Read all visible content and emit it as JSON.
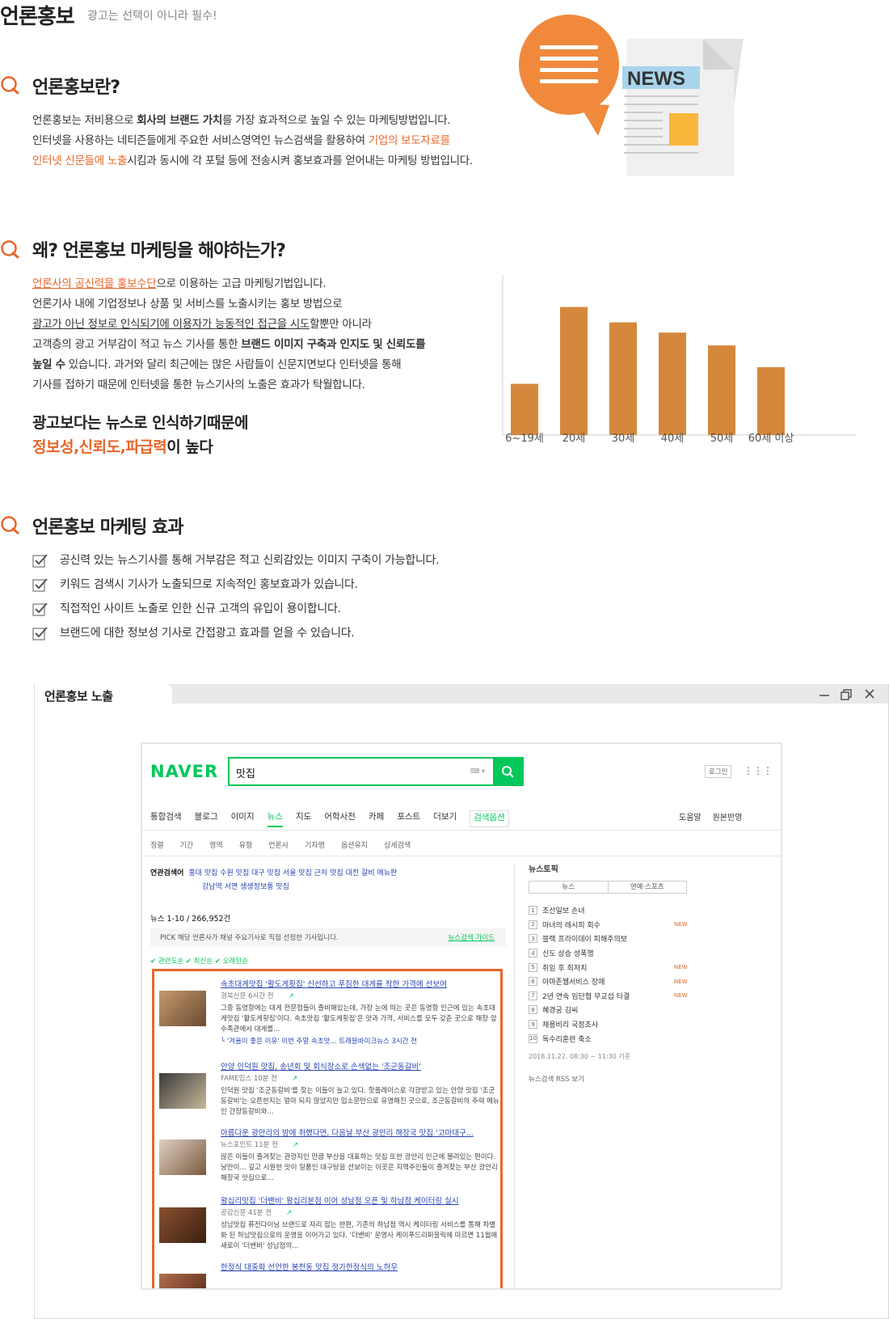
{
  "header": {
    "title": "언론홍보",
    "subtitle": "광고는 선택이 아니라 필수!"
  },
  "hero_icon": {
    "label": "NEWS",
    "colors": {
      "bubble": "#f0893c",
      "paper": "#ececec",
      "tag": "#a9d4ec",
      "square": "#f8b73a"
    }
  },
  "section1": {
    "title": "언론홍보란?",
    "lines": [
      [
        "언론홍보는 저비용으로 ",
        "회사의 브랜드 가치",
        "를 가장 효과적으로 높일 수 있는 마케팅방법입니다."
      ],
      [
        "인터넷을 사용하는 네티즌들에게 주요한 서비스영역인 뉴스검색을 활용하여 ",
        "기업의 보도자료를"
      ],
      [
        "인터넷 신문들에 노출",
        "시킴과 동시에 각 포털 등에 전송시켜 홍보효과를 얻어내는 마케팅 방법입니다."
      ]
    ]
  },
  "section2": {
    "title": "왜? 언론홍보 마케팅을 해야하는가?",
    "line1": [
      "언론사의 공신력을 홍보수단",
      "으로 이용하는 고급 마케팅기법입니다."
    ],
    "line2": "언론기사 내에 기업정보나 상품 및 서비스를 노출시키는 홍보 방법으로",
    "line3": [
      "광고가 아닌 정보로 인식되기에 이용자가 능동적인 접근을 시도",
      "할뿐만 아니라"
    ],
    "line4": [
      "고객층의 광고 거부감이 적고 뉴스 기사를 통한 ",
      "브랜드 이미지 구축과 인지도 및 신뢰도를"
    ],
    "line5": [
      "높일 수",
      " 있습니다. 과거와 달리 최근에는 많은 사람들이 신문지면보다 인터넷을 통해"
    ],
    "line6": "기사를 접하기 때문에 인터넷을 통한 뉴스기사의 노출은 효과가 탁월합니다.",
    "highlight1": "광고보다는 뉴스로 인식하기때문에",
    "highlight2": [
      "정보성,신뢰도,파급력",
      "이 높다"
    ]
  },
  "chart_data": {
    "type": "bar",
    "categories": [
      "6~19세",
      "20세",
      "30세",
      "40세",
      "50세",
      "60세 이상"
    ],
    "values": [
      40,
      100,
      88,
      80,
      70,
      53
    ],
    "ylim": [
      0,
      125
    ],
    "color": "#d5883c"
  },
  "section3": {
    "title": "언론홍보 마케팅 효과",
    "items": [
      "공신력 있는 뉴스기사를 통해 거부감은 적고 신뢰감있는 이미지 구축이 가능합니다.",
      "키워드 검색시 기사가 노출되므로 지속적인 홍보효과가 있습니다.",
      "직접적인 사이트 노출로 인한 신규 고객의 유입이 용이합니다.",
      "브랜드에 대한 정보성 기사로 간접광고 효과를 얻을 수 있습니다."
    ]
  },
  "window": {
    "title": "언론홍보 노출"
  },
  "naver": {
    "logo": "NAVER",
    "query": "맛집",
    "login": "로그인",
    "tabs": [
      "통합검색",
      "블로그",
      "이미지",
      "뉴스",
      "지도",
      "어학사전",
      "카페",
      "포스트",
      "더보기",
      "검색옵션"
    ],
    "tabs_right": [
      "도움말",
      "원본반영"
    ],
    "filters": [
      "정렬",
      "기간",
      "영역",
      "유형",
      "언론사",
      "기자명",
      "옵션유지",
      "상세검색"
    ],
    "related_label": "연관검색어",
    "related1": "홍대 맛집   수원 맛집   대구 맛집   서울 맛집   근처 맛집   대전 갈비   메뉴판",
    "related2": "강남역   서면   생생정보통 맛집",
    "news_count": "뉴스  1-10 / 266,952건",
    "pick": "PICK  해당 언론사가 채널 주요기사로 직접 선정한 기사입니다.",
    "pick_guide": "뉴스검색 가이드",
    "sort": "✔ 관련도순  ✔ 최신순  ✔ 오래된순",
    "results": [
      {
        "title": "속초대게맛집 '활도게횟집' 신선하고 푸짐한 대게를 착한 가격에 선보여",
        "meta": "경북신문  6시간 전",
        "desc": "그중 동명항에는 대게 전문점들이 즐비해있는데, 가장 눈에 띄는 곳은 동명항 인근에 있는 속초대게맛집 '활도게횟집'이다. 속초맛집 '활도게횟집'은 맛과 가격, 서비스를 모두 갖춘 곳으로 해장 앞 수족관에서 대게를...",
        "extra": "└ '겨울이 좋은 이유' 이번 주말 속초맛...   트래블바이크뉴스   3시간 전"
      },
      {
        "title": "안양 인덕원 맛집, 송년회 및 회식장소로 손색없는 '조군동갈비'",
        "meta": "FAME임스  10분 전",
        "desc": "인덕원 맛집 '조군동갈비'를 찾는 이들이 늘고 있다. 핫플레이스로 각광받고 있는 안양 맛집 '조군동갈비'는 오픈한지는 얼마 되지 않았지만 입소문만으로 유명해진 곳으로, 조군동갈비의 주력 메뉴인 간장동갈비와...",
        "extra": ""
      },
      {
        "title": "아름다운 광안리의 밤에 취했다면, 다음날 부산 광안리 해장국 맛집 '고마대구...",
        "meta": "뉴스포인트  11분 전",
        "desc": "많은 이들이 즐겨찾는 관광지인 만큼 부산을 대표하는 맛집 또한 광안리 인근에 몰려있는 편이다. 낭만이... 깊고 시원한 맛이 일품인 대구탕을 선보이는 이곳은 지역주민들이 즐겨찾는 부산 광안리 해장국 맛집으로...",
        "extra": ""
      },
      {
        "title": "왕십리맛집 '더밴비' 왕십리본점 이어 성남점 오픈 및 하남점 케이터링 실시",
        "meta": "공감신문  41분 전",
        "desc": "성남맛집 퓨전다이닝 브랜드로 자리 잡는 한편, 기존의 하남점 역시 케이터링 서비스를 통해 차별화 된 하남맛집으로의 운영을 이어가고 있다. '더밴비' 운영사 케이푸드리퍼블릭에 따르면 11월에 새로이 '더밴비' 성남점의...",
        "extra": ""
      },
      {
        "title": "한정식 대중화 선언한 봉천동 맛집 정가한정식의 노하우",
        "meta": "",
        "desc": "",
        "extra": ""
      }
    ],
    "side": {
      "title": "뉴스토픽",
      "tabs": [
        "뉴스",
        "연예·스포츠"
      ],
      "topics": [
        {
          "n": "1",
          "t": "조선일보 손녀",
          "new": ""
        },
        {
          "n": "2",
          "t": "마녀의 레시피 회수",
          "new": "NEW"
        },
        {
          "n": "3",
          "t": "블랙 프라이데이 피해주의보",
          "new": ""
        },
        {
          "n": "4",
          "t": "신도 상승 성폭행",
          "new": ""
        },
        {
          "n": "5",
          "t": "취임 후 최저치",
          "new": "NEW"
        },
        {
          "n": "6",
          "t": "아마존웹서비스 장애",
          "new": "NEW"
        },
        {
          "n": "7",
          "t": "2년 연속 임단협 무교섭 타결",
          "new": "NEW"
        },
        {
          "n": "8",
          "t": "혜경궁 김씨",
          "new": ""
        },
        {
          "n": "9",
          "t": "채용비리 국정조사",
          "new": ""
        },
        {
          "n": "10",
          "t": "독수리훈련 축소",
          "new": ""
        }
      ],
      "time": "2018.11.22. 08:30 ~ 11:30 기준",
      "rss": "뉴스검색 RSS 보기"
    }
  }
}
